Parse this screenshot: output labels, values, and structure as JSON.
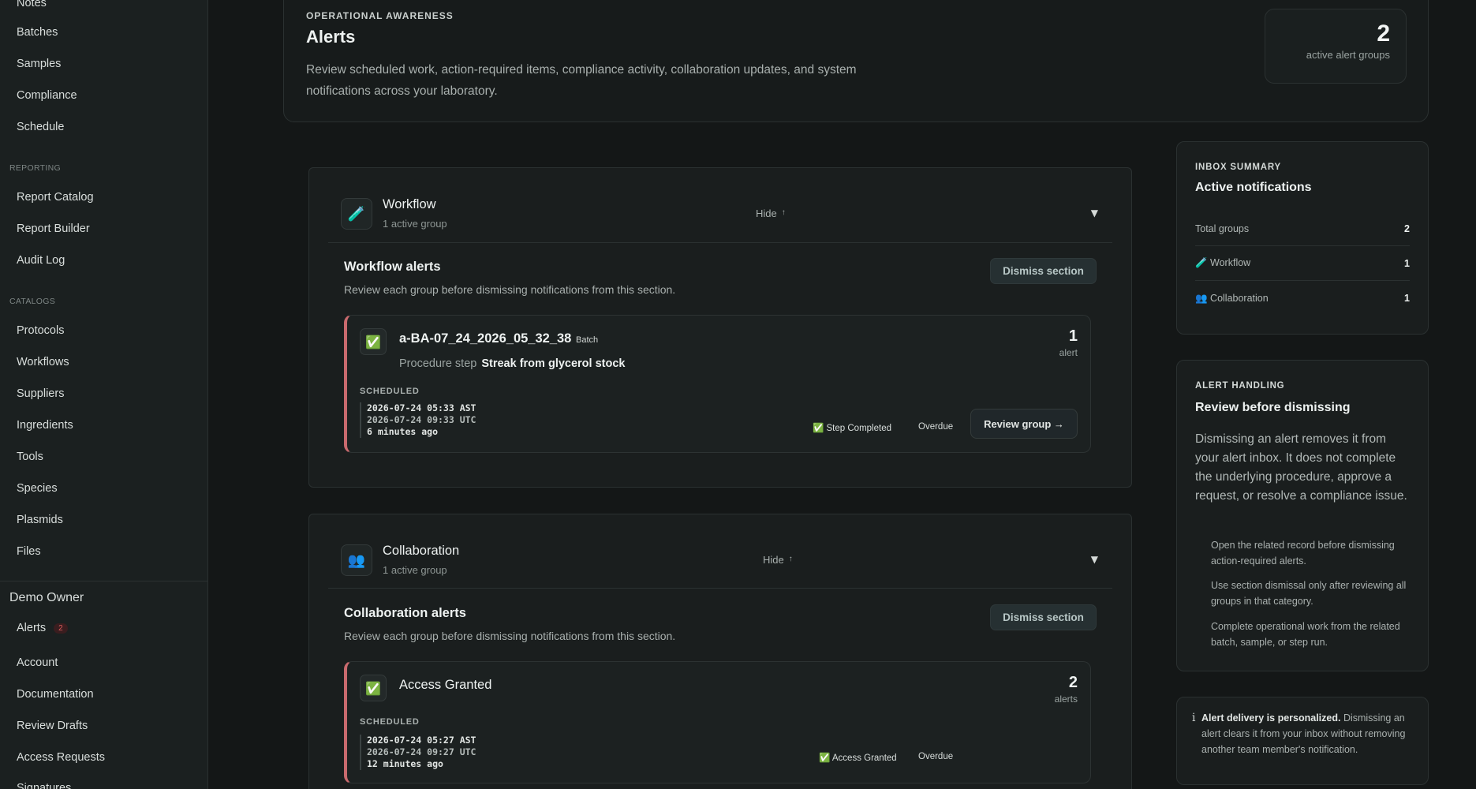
{
  "sidebar": {
    "top_items": [
      "Notes",
      "Batches",
      "Samples",
      "Compliance",
      "Schedule"
    ],
    "reporting_label": "REPORTING",
    "reporting_items": [
      "Report Catalog",
      "Report Builder",
      "Audit Log"
    ],
    "catalogs_label": "CATALOGS",
    "catalogs_items": [
      "Protocols",
      "Workflows",
      "Suppliers",
      "Ingredients",
      "Tools",
      "Species",
      "Plasmids",
      "Files"
    ],
    "user_name": "Demo Owner",
    "alerts_label": "Alerts",
    "alerts_badge": "2",
    "account_items": [
      "Account",
      "Documentation",
      "Review Drafts",
      "Access Requests",
      "Signatures"
    ]
  },
  "header": {
    "eyebrow": "OPERATIONAL AWARENESS",
    "title": "Alerts",
    "description": "Review scheduled work, action-required items, compliance activity, collaboration updates, and system notifications across your laboratory.",
    "stat_value": "2",
    "stat_label": "active alert groups"
  },
  "sections": [
    {
      "icon": "test-tube-icon",
      "icon_glyph": "🧪",
      "title": "Workflow",
      "subtitle": "1 active group",
      "hide_label": "Hide",
      "hide_arrow": "↑",
      "caret": "▼",
      "alerts_title": "Workflow alerts",
      "alerts_desc": "Review each group before dismissing notifications from this section.",
      "dismiss_label": "Dismiss section",
      "group": {
        "check_glyph": "✅",
        "title": "a-BA-07_24_2026_05_32_38",
        "tag": "Batch",
        "step_label": "Procedure step",
        "step_value": "Streak from glycerol stock",
        "count": "1",
        "count_label": "alert",
        "scheduled_label": "SCHEDULED",
        "time_local": "2026-07-24 05:33 AST",
        "time_utc": "2026-07-24 09:33 UTC",
        "time_relative": "6 minutes ago",
        "status_1": "✅ Step Completed",
        "status_2": "Overdue",
        "review_label": "Review group →"
      }
    },
    {
      "icon": "people-icon",
      "icon_glyph": "👥",
      "title": "Collaboration",
      "subtitle": "1 active group",
      "hide_label": "Hide",
      "hide_arrow": "↑",
      "caret": "▼",
      "alerts_title": "Collaboration alerts",
      "alerts_desc": "Review each group before dismissing notifications from this section.",
      "dismiss_label": "Dismiss section",
      "group": {
        "check_glyph": "✅",
        "title": "Access Granted",
        "count": "2",
        "count_label": "alerts",
        "scheduled_label": "SCHEDULED",
        "time_local": "2026-07-24 05:27 AST",
        "time_utc": "2026-07-24 09:27 UTC",
        "time_relative": "12 minutes ago",
        "status_1": "✅ Access Granted",
        "status_2": "Overdue"
      }
    }
  ],
  "inbox_summary": {
    "eyebrow": "INBOX SUMMARY",
    "title": "Active notifications",
    "rows": [
      {
        "label": "Total groups",
        "value": "2"
      },
      {
        "label": "🧪 Workflow",
        "value": "1"
      },
      {
        "label": "👥 Collaboration",
        "value": "1"
      }
    ]
  },
  "alert_handling": {
    "eyebrow": "ALERT HANDLING",
    "title": "Review before dismissing",
    "body": "Dismissing an alert removes it from your alert inbox. It does not complete the underlying procedure, approve a request, or resolve a compliance issue.",
    "tips": [
      "Open the related record before dismissing action-required alerts.",
      "Use section dismissal only after reviewing all groups in that category.",
      "Complete operational work from the related batch, sample, or step run."
    ]
  },
  "info_note": {
    "icon": "i",
    "bold": "Alert delivery is personalized.",
    "text": " Dismissing an alert clears it from your inbox without removing another team member's notification."
  },
  "colors": {
    "background": "#141717",
    "sidebar": "#1b2020",
    "card": "#1a1e1e",
    "alert_accent": "#c96a6e",
    "badge": "#d85b5b"
  }
}
